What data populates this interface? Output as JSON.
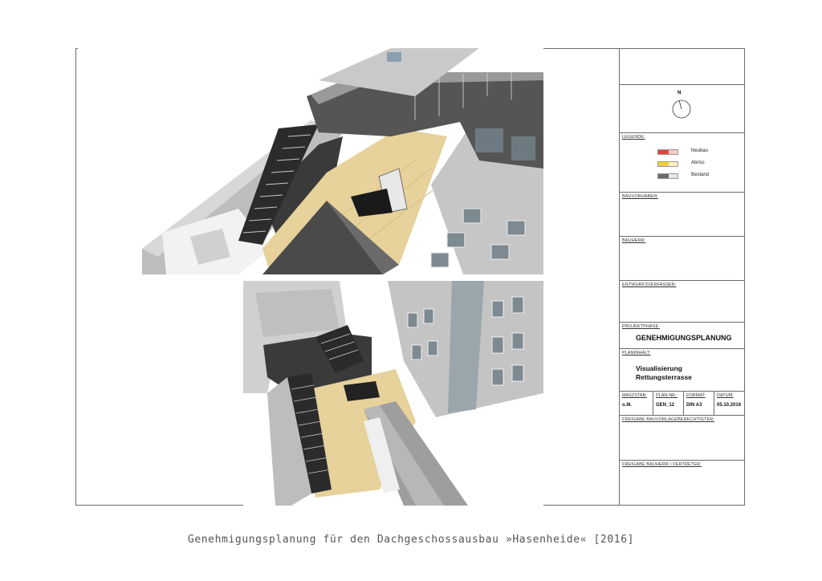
{
  "title_block": {
    "north_label": "N",
    "legend": {
      "label": "LEGENDE:",
      "items": [
        {
          "text": "Neubau",
          "color": "#e2453c"
        },
        {
          "text": "Abriss",
          "color": "#f2cf3a"
        },
        {
          "text": "Bestand",
          "color": "#6a6a6a"
        }
      ]
    },
    "bauvorhaben_label": "BAUVORHABEN:",
    "bauherr_label": "BAUHERR:",
    "entwurfsverfasser_label": "ENTWURFSVERFASSER:",
    "projektphase_label": "PROJEKTPHASE:",
    "projektphase_value": "GENEHMIGUNGSPLANUNG",
    "planinhalt_label": "PLANINHALT:",
    "planinhalt_line1": "Visualisierung",
    "planinhalt_line2": "Rettungsterrasse",
    "massstab_label": "MASZSTAB:",
    "massstab_value": "o.M.",
    "plannr_label": "PLAN-NR.:",
    "plannr_value": "GEN_12",
    "format_label": "FORMAT:",
    "format_value": "DIN A3",
    "datum_label": "DATUM:",
    "datum_value": "05.10.2016",
    "freigabe_bv_label": "FREIGABE BAUVORLAGEBERECHTIGTER:",
    "freigabe_bh_label": "FREIGABE BAUHERR /-VERTRETER:"
  },
  "caption": "Genehmigungsplanung für den Dachgeschossausbau »Hasenheide« [2016]"
}
